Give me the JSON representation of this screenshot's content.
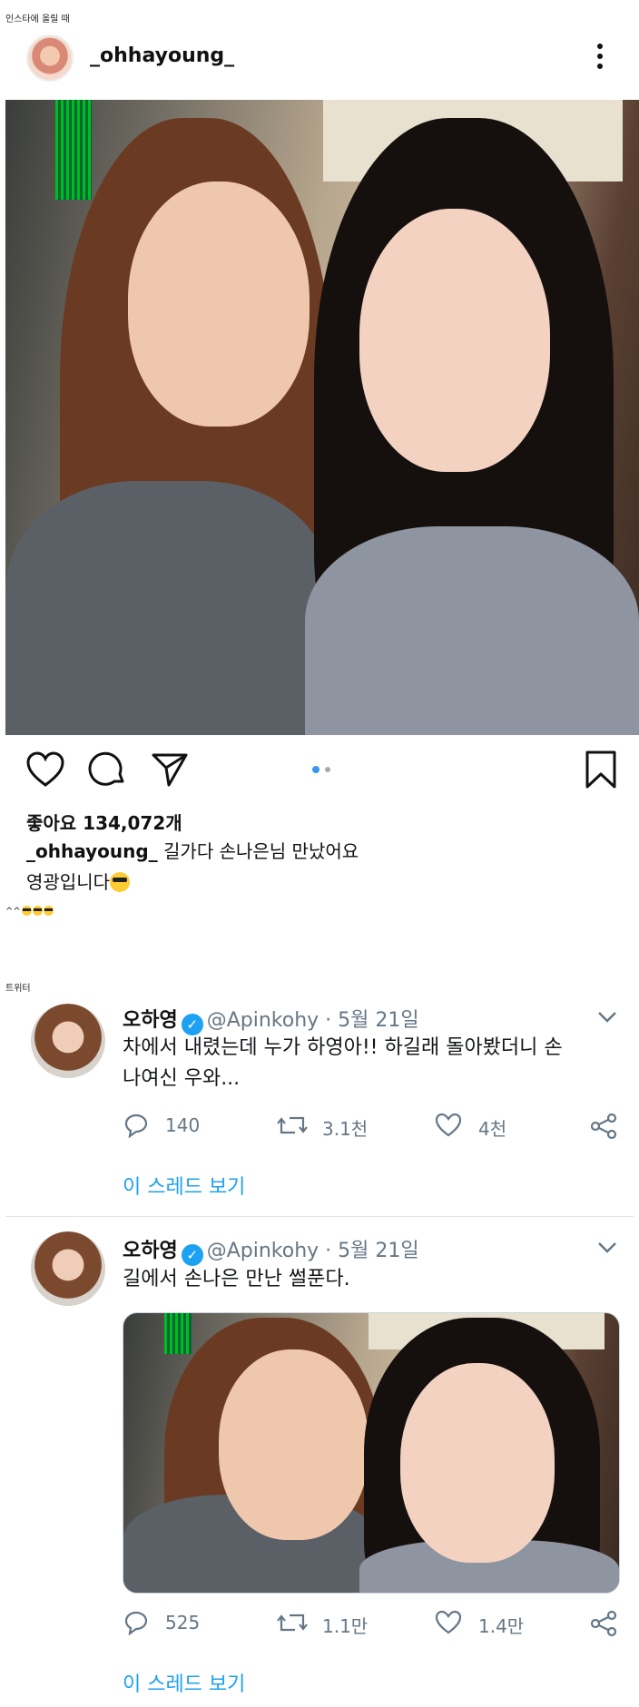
{
  "instagram": {
    "section_caption": "인스타에 올릴 때",
    "username": "_ohhayoung_",
    "likes": "좋아요 134,072개",
    "caption_user": "_ohhayoung_",
    "caption_text": "길가다 손나은님 만났어요",
    "caption_line2": "영광입니다",
    "comment": "^^"
  },
  "twitter": {
    "section_caption": "트위터",
    "tweets": [
      {
        "name": "오하영",
        "handle": "@Apinkohy · 5월 21일",
        "text_line1": "차에서 내렸는데 누가 하영아!! 하길래 돌아봤더니 손",
        "text_line2": "나여신 우와...",
        "replies": "140",
        "retweets": "3.1천",
        "likes": "4천",
        "thread_link": "이 스레드 보기"
      },
      {
        "name": "오하영",
        "handle": "@Apinkohy · 5월 21일",
        "text_line1": "길에서 손나은 만난 썰푼다.",
        "replies": "525",
        "retweets": "1.1만",
        "likes": "1.4만",
        "thread_link": "이 스레드 보기"
      }
    ]
  },
  "colors": {
    "twitter_blue": "#1da1f2",
    "muted": "#657786"
  },
  "icons": [
    "heart-icon",
    "comment-icon",
    "share-icon",
    "bookmark-icon",
    "more-icon",
    "reply-icon",
    "retweet-icon",
    "like-icon",
    "share-node-icon",
    "chevron-down-icon",
    "verified-icon"
  ]
}
